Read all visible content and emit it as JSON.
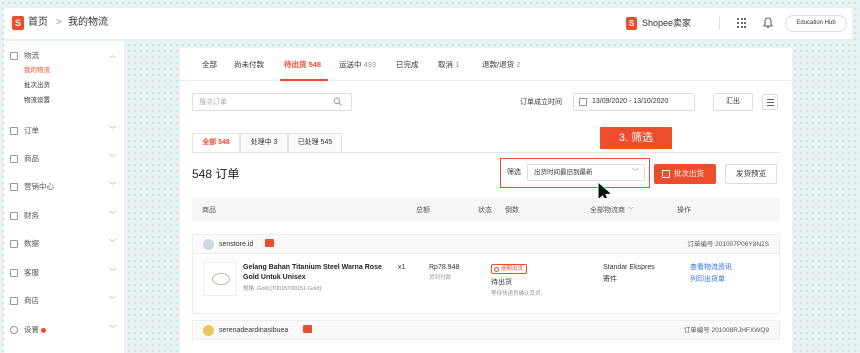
{
  "header": {
    "logo_letter": "S",
    "breadcrumb_home": "首页",
    "breadcrumb_sep": ">",
    "breadcrumb_current": "我的物流",
    "brand": "Shopee卖家",
    "hub_button": "Education Hub"
  },
  "sidebar": {
    "groups": [
      {
        "label": "物流",
        "icon": "shipping-icon",
        "expanded": true
      },
      {
        "label": "订单",
        "icon": "order-icon"
      },
      {
        "label": "商品",
        "icon": "product-icon"
      },
      {
        "label": "营销中心",
        "icon": "tag-icon"
      },
      {
        "label": "财务",
        "icon": "wallet-icon"
      },
      {
        "label": "数据",
        "icon": "chart-icon"
      },
      {
        "label": "客服",
        "icon": "chat-icon"
      },
      {
        "label": "商店",
        "icon": "shop-icon"
      },
      {
        "label": "设置",
        "icon": "gear-icon"
      }
    ],
    "sub_items": [
      "我的物流",
      "批次出货",
      "物流设置"
    ]
  },
  "tabs": [
    {
      "label": "全部",
      "count": ""
    },
    {
      "label": "尚未付款",
      "count": ""
    },
    {
      "label": "待出货",
      "count": "548",
      "active": true
    },
    {
      "label": "运送中",
      "count": "493"
    },
    {
      "label": "已完成",
      "count": ""
    },
    {
      "label": "取消",
      "count": "1"
    },
    {
      "label": "退款/退货",
      "count": "2"
    }
  ],
  "search": {
    "placeholder": "搜寻订单"
  },
  "date_filter": {
    "label": "订单成立时间",
    "range": "13/09/2020 - 13/10/2020"
  },
  "export_button": "汇出",
  "sub_tabs": [
    {
      "label": "全部 548",
      "active": true
    },
    {
      "label": "处理中 3"
    },
    {
      "label": "已处理 545"
    }
  ],
  "orders_count": "548 订单",
  "filter": {
    "label": "筛选",
    "selected": "出货时间最旧到最新"
  },
  "callout": "3. 筛选",
  "batch_ship_button": "批次出货",
  "preview_button": "发货预览",
  "table_headers": {
    "product": "商品",
    "total": "总额",
    "status": "状态",
    "countdown": "倒数",
    "channel": "全部物流商",
    "action": "操作"
  },
  "orders": [
    {
      "username": "senstore.id",
      "order_id": "订单编号 201007P06Y8N2S",
      "product_name": "Gelang Bahan Titanium Steel Warna Rose Gold Untuk Unisex",
      "quantity": "x1",
      "variation": "规格: Gold [T0015T00151-Gold]",
      "price": "Rp78.948",
      "payment": "货到付款",
      "badge": "逾期出货",
      "status": "待出货",
      "status_note": "等待快递员确认其货。",
      "carrier": "Standar Ekspres",
      "carrier_detail": "寄件",
      "actions": [
        "查看物流资讯",
        "列印出货单"
      ]
    },
    {
      "username": "serenadeardinasibuea",
      "order_id": "订单编号 201008RJHFXWQ9"
    }
  ],
  "colors": {
    "accent": "#ee4d2d",
    "link": "#2673dd"
  }
}
